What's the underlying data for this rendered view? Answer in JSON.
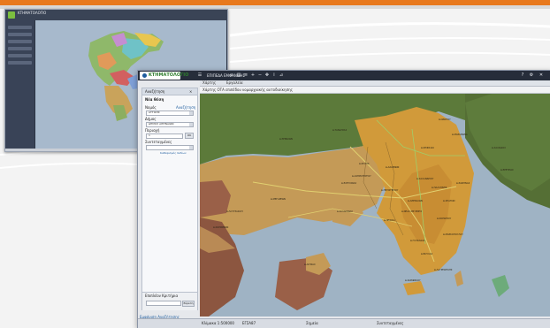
{
  "colors": {
    "accent": "#e8791e",
    "toolbar": "#262d3a",
    "brand_green": "#7cbf3f",
    "sea": "#9fb3c4",
    "land_green": "#5c7a3a",
    "land_tan": "#c49a57",
    "land_orange": "#d19a3a",
    "land_brown": "#9a6048"
  },
  "back_window": {
    "title": "ΚΤΗΜΑΤΟΛΟΓΙΟ"
  },
  "front_window": {
    "app_name": "ΚΤΗΜΑΤΟΛΟΓΙΟ",
    "toolbar": {
      "label": "ΕΠΙΠΕΔΑ ΕΜΦΑΝΙΣΗΣ",
      "icons": [
        "home-icon",
        "print-icon",
        "layers-icon",
        "zoom-in-icon",
        "zoom-out-icon",
        "pan-icon",
        "info-icon",
        "measure-icon",
        "help-icon",
        "close-icon"
      ]
    },
    "sub_bar": {
      "item1": "Χάρτης",
      "item2": "Εργαλεία"
    },
    "map_header": "Χάρτης ΟΤΑ επιπέδου νομαρχιακής αυτοδιοίκησης",
    "panel": {
      "header": "Αναζήτηση",
      "section_title": "Νέα Θέση",
      "field1_label": "Νομός",
      "field1_link": "Αναζήτηση",
      "field1_value": "ΑΤΤΙΚΗΣ",
      "field2_label": "Δήμος",
      "field2_value": "ΔΗΜΟΣ ΑΘΗΝΑΙΩΝ",
      "field3_label": "Περιοχή",
      "field3_value": "1",
      "field4_label": "Συντεταγμένες",
      "field4_value": "",
      "go_label": "OK",
      "small_link": "Καθαρισμός πεδίων",
      "bottom_title": "Επιπλέον Κριτήρια",
      "bottom_btn": "Εύρεση",
      "footer_link": "Εμφάνιση Αναζήτησης"
    },
    "status": {
      "left": "Κλίμακα 1:500000",
      "mid_left": "ΕΓΣΑ87",
      "center": "Σημεία",
      "right": "Συντεταγμένες"
    },
    "map_labels": [
      "Δ.ΑΘΗΝΑΙΩΝ",
      "Δ.ΠΕΙΡΑΙΑ",
      "Δ.ΚΗΦΙΣΙΑΣ",
      "Δ.ΜΑΡΑΘΩΝΑ",
      "Δ.ΕΛΕΥΣΙΝΑΣ",
      "Δ.ΜΕΓΑΡΕΩΝ",
      "Δ.ΣΑΛΑΜΙΝΑΣ",
      "Δ.ΑΧΑΡΝΩΝ",
      "Δ.ΓΛΥΦΑΔΑΣ",
      "Δ.ΒΟΥΛΑΣ",
      "Δ.ΛΑΥΡΕΩΤΙΚΗΣ",
      "Δ.ΑΙΓΙΝΑΣ",
      "Δ.ΦΥΛΗΣ",
      "Δ.ΩΡΩΠΟΥ",
      "Δ.ΣΠΑΤΩΝ",
      "Δ.ΠΑΛΛΗΝΗΣ",
      "Δ.ΚΟΡΩΠΙΟΥ",
      "Δ.ΜΑΡΚΟΠΟΥΛΟΥ",
      "Δ.ΧΑΛΚΙΔΟΣ",
      "Δ.ΤΑΝΑΓΡΑΣ",
      "Δ.ΘΗΒΑΙΩΝ",
      "Δ.ΚΟΡΙΝΘΙΩΝ",
      "Δ.ΛΟΥΤΡΑΚΙΟΥ",
      "Δ.ΕΡΕΤΡΙΑΣ",
      "Δ.ΣΑΡΩΝΙΚΟΥ",
      "Δ.ΝΕΑΣ ΣΜΥΡΝΗΣ",
      "Δ.ΠΕΡΙΣΤΕΡΙΟΥ",
      "Δ.ΧΑΛΑΝΔΡΙΟΥ",
      "Δ.ΡΑΦΗΝΑΣ",
      "Δ.ΑΣΠΡΟΠΥΡΓΟΥ"
    ]
  }
}
